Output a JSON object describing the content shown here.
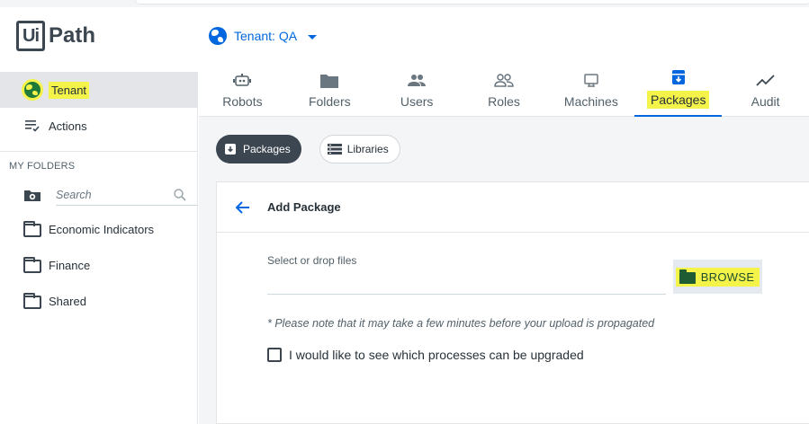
{
  "brand": {
    "logo_mark": "Ui",
    "logo_text": "Path"
  },
  "header": {
    "tenant_label": "Tenant: QA",
    "tenant_icon": "globe-icon"
  },
  "sidebar": {
    "items": [
      {
        "label": "Tenant",
        "icon": "globe-icon",
        "active": true
      },
      {
        "label": "Actions",
        "icon": "actions-list-icon"
      }
    ],
    "section_title": "MY FOLDERS",
    "search": {
      "placeholder": "Search"
    },
    "folders": [
      {
        "label": "Economic Indicators"
      },
      {
        "label": "Finance"
      },
      {
        "label": "Shared"
      }
    ]
  },
  "tabs": [
    {
      "label": "Robots",
      "icon": "robot-icon"
    },
    {
      "label": "Folders",
      "icon": "folder-icon"
    },
    {
      "label": "Users",
      "icon": "users-icon"
    },
    {
      "label": "Roles",
      "icon": "roles-icon"
    },
    {
      "label": "Machines",
      "icon": "monitor-icon"
    },
    {
      "label": "Packages",
      "icon": "package-icon",
      "active": true
    },
    {
      "label": "Audit",
      "icon": "trend-icon"
    }
  ],
  "subtabs": [
    {
      "label": "Packages",
      "icon": "package-icon",
      "active": true
    },
    {
      "label": "Libraries",
      "icon": "library-icon"
    }
  ],
  "card": {
    "title": "Add Package",
    "file_label": "Select or drop files",
    "browse_label": "BROWSE",
    "note": "* Please note that it may take a few minutes before your upload is propagated",
    "checkbox_label": "I would like to see which processes can be upgraded"
  },
  "colors": {
    "accent": "#0067df",
    "highlight": "#f3f34a",
    "dark": "#3c4650"
  }
}
